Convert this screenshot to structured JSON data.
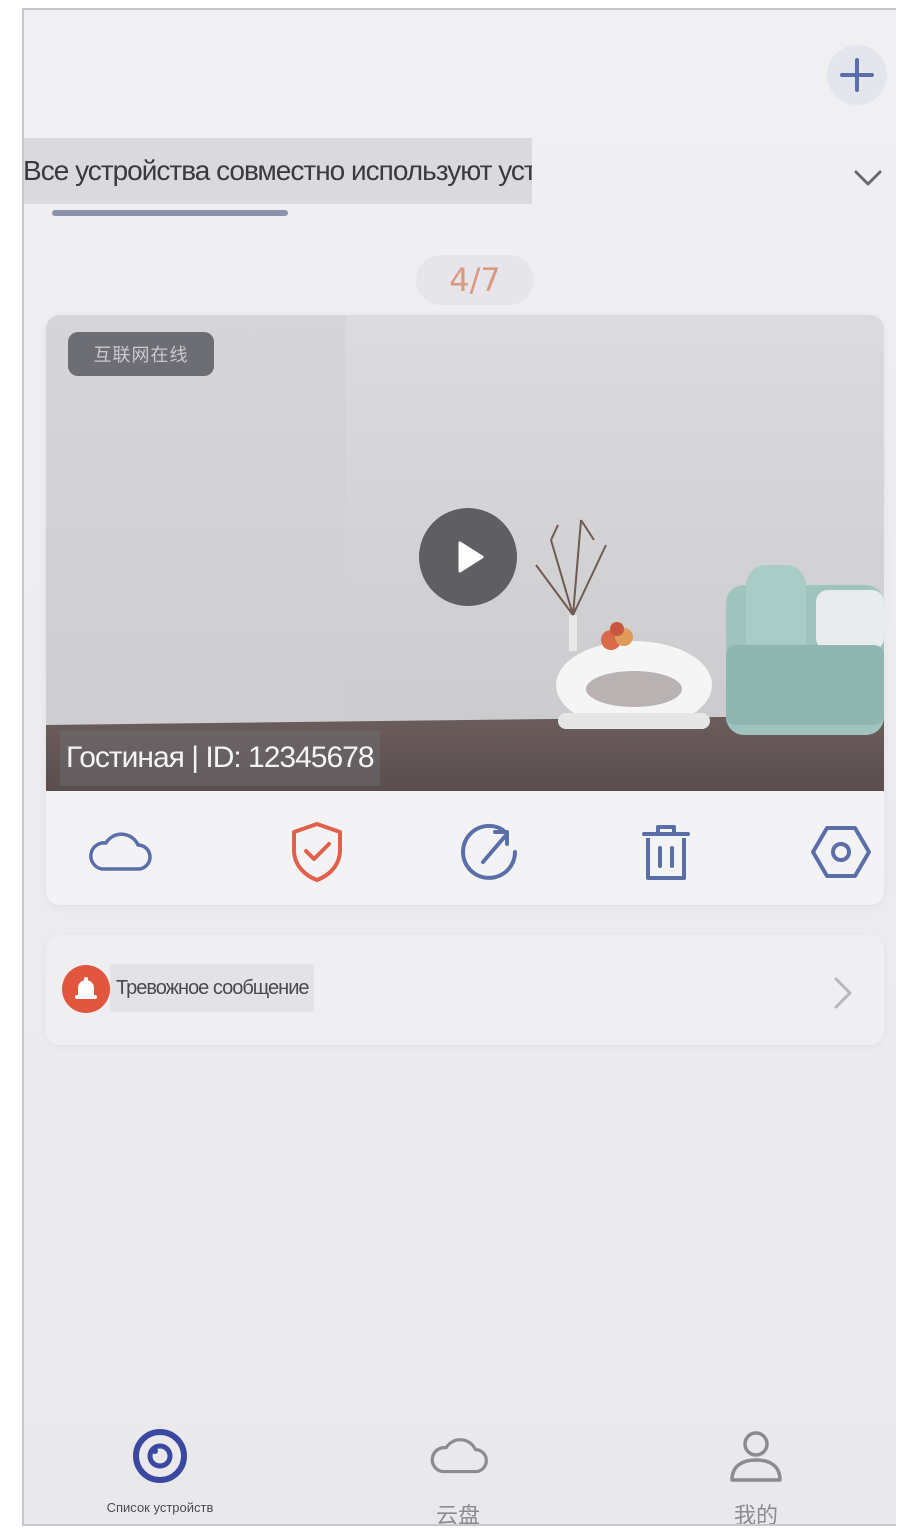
{
  "header": {
    "add_icon": "plus-icon",
    "filter_label": "| Все устройства совместно используют устройства",
    "filter_icon": "chevron-down-icon"
  },
  "pager": {
    "text": "4/7"
  },
  "device_card": {
    "tag": "互联网在线",
    "play_icon": "play-icon",
    "caption": "Гостиная | ID: 12345678",
    "actions": [
      {
        "name": "cloud-icon",
        "color": "#5a6ea8"
      },
      {
        "name": "shield-check-icon",
        "color": "#e0604a"
      },
      {
        "name": "share-icon",
        "color": "#5a6ea8"
      },
      {
        "name": "trash-icon",
        "color": "#5a6ea8"
      },
      {
        "name": "settings-hexagon-icon",
        "color": "#5a6ea8"
      }
    ]
  },
  "alarm": {
    "label": "Тревожное сообщение",
    "icon": "alarm-bell-icon",
    "arrow_icon": "chevron-right-icon",
    "accent": "#e2553e"
  },
  "tabbar": {
    "tabs": [
      {
        "label": "Список устройств",
        "icon": "camera-lens-icon",
        "active": true
      },
      {
        "label": "云盘",
        "icon": "cloud-icon",
        "active": false
      },
      {
        "label": "我的",
        "icon": "user-icon",
        "active": false
      }
    ],
    "accent": "#3a48a0"
  }
}
